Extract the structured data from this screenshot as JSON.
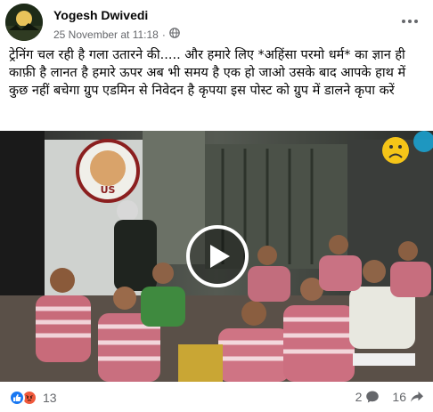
{
  "post": {
    "author": "Yogesh Dwivedi",
    "timestamp": "25 November at 11:18",
    "separator": "·",
    "audience_icon": "globe-icon",
    "text": "ट्रेनिंग चल रही है गला उतारने की..... और हमारे लिए *अहिंसा परमो धर्म* का ज्ञान ही काफ़ी है लानत है हमारे ऊपर अब भी समय है एक हो जाओ उसके बाद आपके हाथ में कुछ नहीं बचेगा ग्रुप एडमिन से निवेदन है कृपया इस पोस्ट को ग्रुप में डालने कृपा करें"
  },
  "video": {
    "play_icon": "play-icon",
    "overlay_emoji": "☹",
    "wall_logo_text": "US"
  },
  "footer": {
    "reaction_icons": [
      "like-icon",
      "angry-icon"
    ],
    "reaction_count": "13",
    "comment_count": "2",
    "comment_icon": "comment-icon",
    "share_count": "16",
    "share_icon": "share-icon"
  },
  "colors": {
    "brand_blue": "#1877f2",
    "angry": "#f0593c",
    "secondary_text": "#65676b"
  }
}
